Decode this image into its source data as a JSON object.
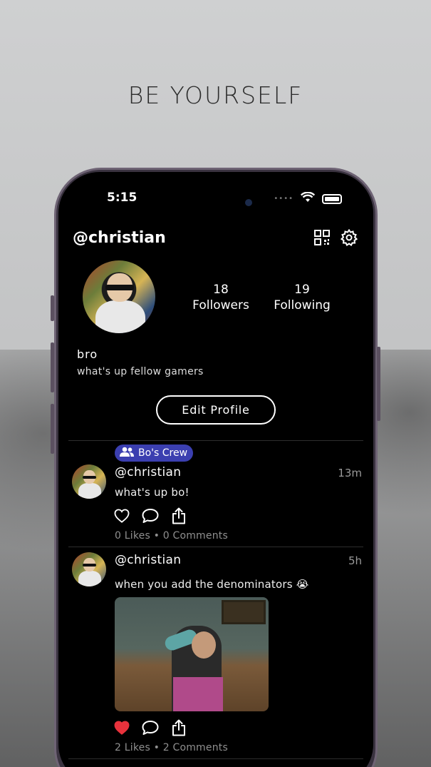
{
  "headline": "BE YOURSELF",
  "status_bar": {
    "time": "5:15",
    "dots": "••••"
  },
  "profile": {
    "handle": "@christian",
    "followers_count": "18",
    "followers_label": "Followers",
    "following_count": "19",
    "following_label": "Following",
    "bio_name": "bro",
    "bio_text": "what's up fellow gamers",
    "edit_label": "Edit Profile"
  },
  "posts": [
    {
      "group": "Bo's Crew",
      "user": "@christian",
      "time": "13m",
      "text": "what's up bo!",
      "liked": false,
      "counts": "0 Likes • 0 Comments"
    },
    {
      "user": "@christian",
      "time": "5h",
      "text": "when you add the denominators 😭",
      "liked": true,
      "counts": "2 Likes • 2 Comments"
    }
  ],
  "colors": {
    "badge": "#3b3fb0",
    "like": "#e8323c",
    "screen": "#000000"
  }
}
